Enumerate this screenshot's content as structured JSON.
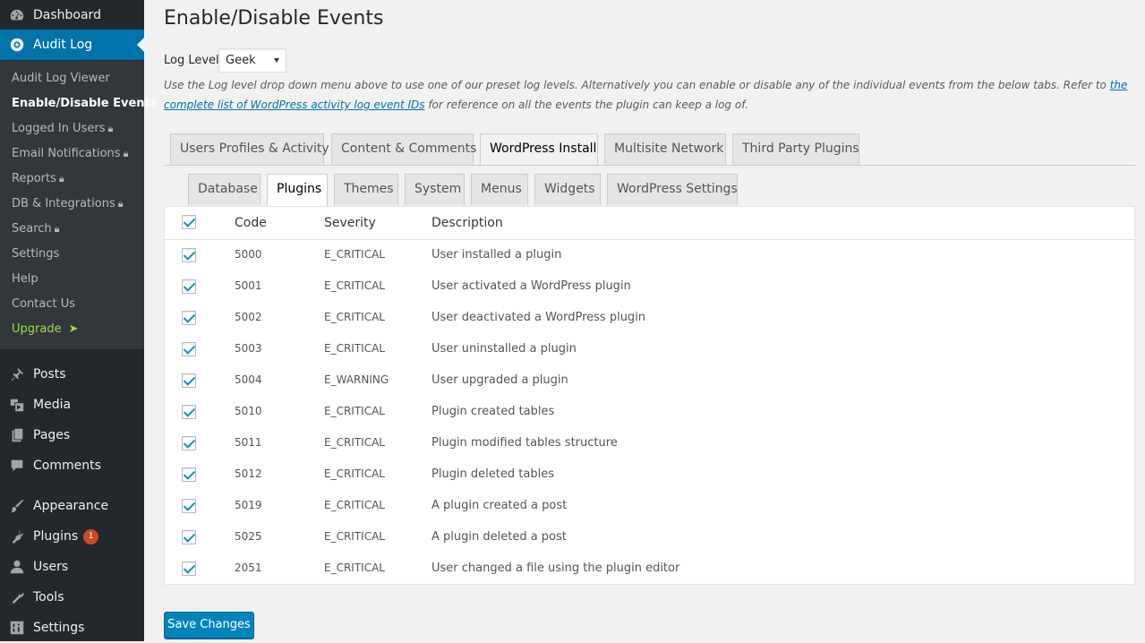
{
  "sidebar": {
    "top_items": [
      {
        "label": "Dashboard",
        "icon": "dashboard-icon"
      },
      {
        "label": "Audit Log",
        "icon": "audit-log-icon",
        "active": true
      }
    ],
    "submenu": [
      {
        "label": "Audit Log Viewer"
      },
      {
        "label": "Enable/Disable Events",
        "current": true
      },
      {
        "label": "Logged In Users",
        "locked": true
      },
      {
        "label": "Email Notifications",
        "locked": true
      },
      {
        "label": "Reports",
        "locked": true
      },
      {
        "label": "DB & Integrations",
        "locked": true
      },
      {
        "label": "Search",
        "locked": true
      },
      {
        "label": "Settings"
      },
      {
        "label": "Help"
      },
      {
        "label": "Contact Us"
      },
      {
        "label": "Upgrade",
        "icon": "arrow-right-icon",
        "color": "#9bdb4c"
      }
    ],
    "bottom_items": [
      {
        "label": "Posts",
        "icon": "pushpin-icon"
      },
      {
        "label": "Media",
        "icon": "media-icon"
      },
      {
        "label": "Pages",
        "icon": "pages-icon"
      },
      {
        "label": "Comments",
        "icon": "comment-icon"
      },
      {
        "label": "Appearance",
        "icon": "paintbrush-icon"
      },
      {
        "label": "Plugins",
        "icon": "plugin-icon",
        "badge": "1"
      },
      {
        "label": "Users",
        "icon": "user-icon"
      },
      {
        "label": "Tools",
        "icon": "wrench-icon"
      },
      {
        "label": "Settings",
        "icon": "settings-sliders-icon"
      }
    ]
  },
  "page": {
    "title": "Enable/Disable Events",
    "log_level_label": "Log Level:",
    "log_level_value": "Geek",
    "help_text_before": "Use the Log level drop down menu above to use one of our preset log levels. Alternatively you can enable or disable any of the individual events from the below tabs. Refer to ",
    "help_link": "the complete list of WordPress activity log event IDs",
    "help_text_after": " for reference on all the events the plugin can keep a log of."
  },
  "tabs": [
    {
      "label": "Users Profiles & Activity"
    },
    {
      "label": "Content & Comments"
    },
    {
      "label": "WordPress Install",
      "active": true
    },
    {
      "label": "Multisite Network"
    },
    {
      "label": "Third Party Plugins"
    }
  ],
  "subtabs": [
    {
      "label": "Database"
    },
    {
      "label": "Plugins",
      "active": true
    },
    {
      "label": "Themes"
    },
    {
      "label": "System"
    },
    {
      "label": "Menus"
    },
    {
      "label": "Widgets"
    },
    {
      "label": "WordPress Settings"
    }
  ],
  "table": {
    "headers": {
      "code": "Code",
      "severity": "Severity",
      "description": "Description"
    },
    "rows": [
      {
        "checked": true,
        "code": "5000",
        "severity": "E_CRITICAL",
        "description": "User installed a plugin"
      },
      {
        "checked": true,
        "code": "5001",
        "severity": "E_CRITICAL",
        "description": "User activated a WordPress plugin"
      },
      {
        "checked": true,
        "code": "5002",
        "severity": "E_CRITICAL",
        "description": "User deactivated a WordPress plugin"
      },
      {
        "checked": true,
        "code": "5003",
        "severity": "E_CRITICAL",
        "description": "User uninstalled a plugin"
      },
      {
        "checked": true,
        "code": "5004",
        "severity": "E_WARNING",
        "description": "User upgraded a plugin"
      },
      {
        "checked": true,
        "code": "5010",
        "severity": "E_CRITICAL",
        "description": "Plugin created tables"
      },
      {
        "checked": true,
        "code": "5011",
        "severity": "E_CRITICAL",
        "description": "Plugin modified tables structure"
      },
      {
        "checked": true,
        "code": "5012",
        "severity": "E_CRITICAL",
        "description": "Plugin deleted tables"
      },
      {
        "checked": true,
        "code": "5019",
        "severity": "E_CRITICAL",
        "description": "A plugin created a post"
      },
      {
        "checked": true,
        "code": "5025",
        "severity": "E_CRITICAL",
        "description": "A plugin deleted a post"
      },
      {
        "checked": true,
        "code": "2051",
        "severity": "E_CRITICAL",
        "description": "User changed a file using the plugin editor"
      }
    ]
  },
  "save_button_label": "Save Changes",
  "colors": {
    "accent": "#0073aa",
    "sidebar_bg": "#23282d",
    "submenu_bg": "#32373c",
    "button": "#0085ba",
    "upgrade": "#9bdb4c",
    "badge": "#ca4a1f"
  }
}
